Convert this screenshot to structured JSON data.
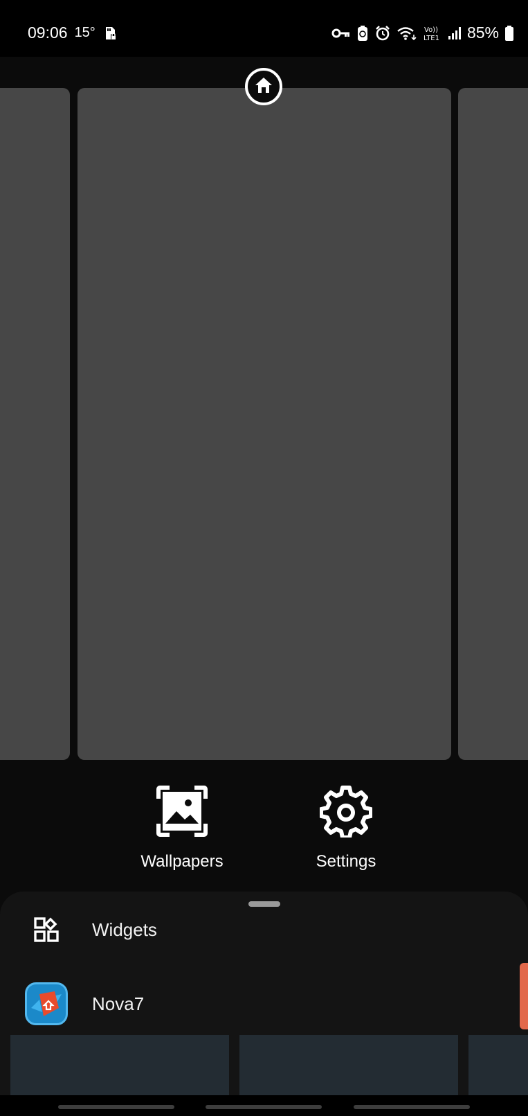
{
  "status_bar": {
    "time": "09:06",
    "temperature": "15°",
    "battery_percent": "85%",
    "network_label": "Vo)) LTE1",
    "left_icons": [
      "sd-card-icon"
    ],
    "right_icons": [
      "vpn-key-icon",
      "battery-saver-icon",
      "alarm-icon",
      "wifi-icon",
      "volte-icon",
      "signal-icon",
      "battery-icon"
    ]
  },
  "editor": {
    "pages": [
      "left-page",
      "current-page",
      "right-page"
    ],
    "home_page_icon": "home-icon"
  },
  "actions": {
    "wallpapers_label": "Wallpapers",
    "settings_label": "Settings"
  },
  "drawer": {
    "items": [
      {
        "label": "Widgets",
        "icon": "widgets-icon"
      },
      {
        "label": "Nova7",
        "icon": "nova-launcher-icon"
      }
    ]
  },
  "colors": {
    "background": "#0b0b0b",
    "page_card": "#474747",
    "drawer": "#141414",
    "scroll_accent": "#e2694b",
    "nova_blue": "#1b89c9",
    "nova_red": "#e84b2c"
  }
}
